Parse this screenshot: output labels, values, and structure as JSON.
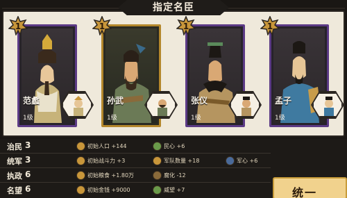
{
  "title": "指定名臣",
  "colors": {
    "panel": "#efe9db",
    "selected_border": "#b4872b",
    "card_border": "#5b3a85",
    "dark": "#1d1a17",
    "gold_button": "#f1d28d"
  },
  "cards": [
    {
      "name": "范蠡",
      "level": "1级",
      "badge": "1",
      "selected": false
    },
    {
      "name": "孙武",
      "level": "1级",
      "badge": "1",
      "selected": true
    },
    {
      "name": "张仪",
      "level": "1级",
      "badge": "1",
      "selected": false
    },
    {
      "name": "孟子",
      "level": "1级",
      "badge": "1",
      "selected": false
    }
  ],
  "stats": [
    {
      "label": "治民",
      "value": "3",
      "effects": [
        {
          "icon": "population-icon",
          "text": "初始人口 +144"
        },
        {
          "icon": "grain-icon",
          "text": "民心 +6"
        }
      ]
    },
    {
      "label": "统军",
      "value": "3",
      "effects": [
        {
          "icon": "army-icon",
          "text": "初始战斗力 +3"
        },
        {
          "icon": "troop-icon",
          "text": "军队数量 +18"
        },
        {
          "icon": "morale-icon",
          "text": "军心 +6"
        }
      ]
    },
    {
      "label": "执政",
      "value": "6",
      "effects": [
        {
          "icon": "food-icon",
          "text": "初始粮食 +1.80万"
        },
        {
          "icon": "corruption-icon",
          "text": "腐化 -12"
        }
      ]
    },
    {
      "label": "名望",
      "value": "6",
      "effects": [
        {
          "icon": "gold-icon",
          "text": "初始金钱 +9000"
        },
        {
          "icon": "prestige-icon",
          "text": "威望 +7"
        }
      ]
    }
  ],
  "button": {
    "label": "统一"
  }
}
